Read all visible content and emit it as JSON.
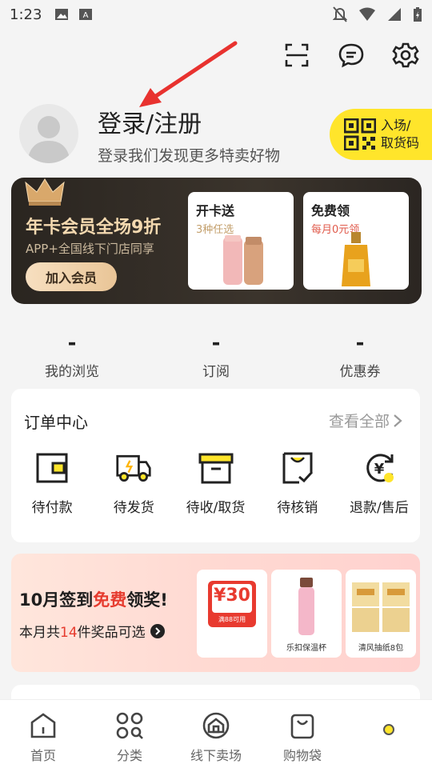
{
  "status_bar": {
    "time": "1:23"
  },
  "profile": {
    "title": "登录/注册",
    "subtitle": "登录我们发现更多特卖好物",
    "pickup_line1": "入场/",
    "pickup_line2": "取货码"
  },
  "member": {
    "title": "年卡会员全场9折",
    "subtitle": "APP+全国线下门店同享",
    "join_label": "加入会员",
    "card1_title": "开卡送",
    "card1_sub": "3种任选",
    "card2_title": "免费领",
    "card2_sub": "每月0元领"
  },
  "stats": [
    {
      "value": "-",
      "label": "我的浏览"
    },
    {
      "value": "-",
      "label": "订阅"
    },
    {
      "value": "-",
      "label": "优惠券"
    }
  ],
  "orders": {
    "title": "订单中心",
    "view_all": "查看全部",
    "items": [
      {
        "label": "待付款",
        "icon": "wallet-icon"
      },
      {
        "label": "待发货",
        "icon": "truck-icon"
      },
      {
        "label": "待收/取货",
        "icon": "box-icon"
      },
      {
        "label": "待核销",
        "icon": "verify-icon"
      },
      {
        "label": "退款/售后",
        "icon": "refund-icon"
      }
    ]
  },
  "signin": {
    "title_part1": "10月",
    "title_part2": "签到",
    "title_part3": "免费",
    "title_part4": "领奖!",
    "sub_part1": "本月共",
    "sub_count": "14",
    "sub_part2": "件奖品可选",
    "coupon_value": "¥30",
    "coupon_note": "满88可用",
    "prize2_label": "乐扣保温杯",
    "prize3_label": "清风抽纸8包"
  },
  "nav": [
    {
      "label": "首页"
    },
    {
      "label": "分类"
    },
    {
      "label": "线下卖场"
    },
    {
      "label": "购物袋"
    }
  ],
  "colors": {
    "accent_yellow": "#ffe52b",
    "accent_red": "#e63b2e",
    "banner_dark": "#2a2520"
  }
}
